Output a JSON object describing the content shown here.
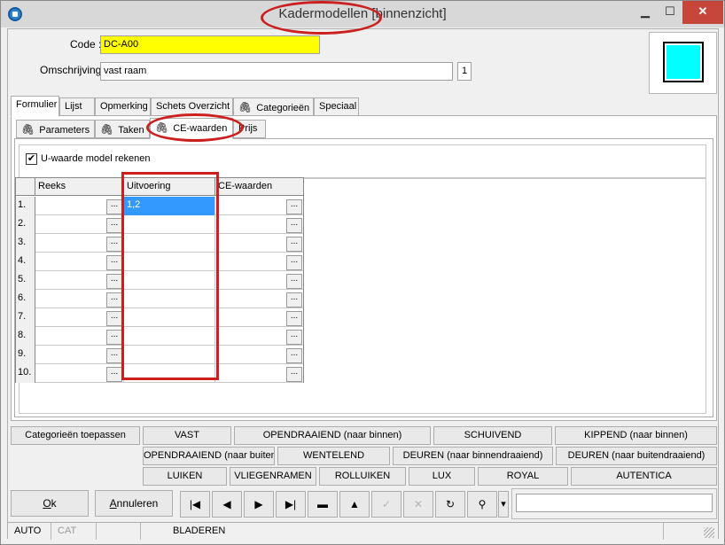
{
  "window": {
    "title": "Kadermodellen [binnenzicht]",
    "minimize_glyph": "▁",
    "maximize_glyph": "☐",
    "close_glyph": "✕"
  },
  "form": {
    "code_label": "Code :",
    "code_value": "DC-A00",
    "description_label": "Omschrijving :",
    "description_value": "vast raam",
    "count_value": "1",
    "swatch_color": "#00ffff"
  },
  "tabs": [
    {
      "label": "Formulier",
      "active": true
    },
    {
      "label": "Lijst"
    },
    {
      "label": "Opmerking"
    },
    {
      "label": "Schets Overzicht"
    },
    {
      "label": "Categorieën",
      "icon": "paperclip-icon"
    },
    {
      "label": "Speciaal"
    }
  ],
  "subtabs": [
    {
      "label": "Parameters",
      "icon": "paperclip-icon"
    },
    {
      "label": "Taken",
      "icon": "paperclip-icon"
    },
    {
      "label": "CE-waarden",
      "icon": "paperclip-icon",
      "active": true
    },
    {
      "label": "Prijs"
    }
  ],
  "checkbox": {
    "label": "U-waarde model rekenen",
    "checked": true
  },
  "grid": {
    "columns": [
      "Reeks",
      "Uitvoering",
      "CE-waarden"
    ],
    "rows": [
      {
        "num": "1.",
        "reeks": "",
        "uitvoering": "1,2",
        "ce": "",
        "selected": true
      },
      {
        "num": "2.",
        "reeks": "",
        "uitvoering": "",
        "ce": ""
      },
      {
        "num": "3.",
        "reeks": "",
        "uitvoering": "",
        "ce": ""
      },
      {
        "num": "4.",
        "reeks": "",
        "uitvoering": "",
        "ce": ""
      },
      {
        "num": "5.",
        "reeks": "",
        "uitvoering": "",
        "ce": ""
      },
      {
        "num": "6.",
        "reeks": "",
        "uitvoering": "",
        "ce": ""
      },
      {
        "num": "7.",
        "reeks": "",
        "uitvoering": "",
        "ce": ""
      },
      {
        "num": "8.",
        "reeks": "",
        "uitvoering": "",
        "ce": ""
      },
      {
        "num": "9.",
        "reeks": "",
        "uitvoering": "",
        "ce": ""
      },
      {
        "num": "10.",
        "reeks": "",
        "uitvoering": "",
        "ce": ""
      }
    ],
    "ellipsis": "..."
  },
  "category_apply_label": "Categorieën toepassen",
  "category_buttons": [
    [
      "VAST",
      "OPENDRAAIEND (naar binnen)",
      "SCHUIVEND",
      "KIPPEND (naar binnen)"
    ],
    [
      "OPENDRAAIEND (naar buiten)",
      "WENTELEND",
      "DEUREN (naar binnendraaiend)",
      "DEUREN (naar buitendraaiend)"
    ],
    [
      "LUIKEN",
      "VLIEGENRAMEN",
      "ROLLUIKEN",
      "LUX",
      "ROYAL",
      "AUTENTICA"
    ]
  ],
  "actions": {
    "ok_first": "O",
    "ok_rest": "k",
    "cancel_first": "A",
    "cancel_rest": "nnuleren"
  },
  "nav_buttons": [
    {
      "name": "first-record-icon",
      "glyph": "|◀"
    },
    {
      "name": "previous-record-icon",
      "glyph": "◀"
    },
    {
      "name": "next-record-icon",
      "glyph": "▶"
    },
    {
      "name": "last-record-icon",
      "glyph": "▶|"
    },
    {
      "name": "delete-record-icon",
      "glyph": "▬"
    },
    {
      "name": "edit-record-icon",
      "glyph": "▲"
    },
    {
      "name": "confirm-icon",
      "glyph": "✓",
      "disabled": true
    },
    {
      "name": "cancel-edit-icon",
      "glyph": "✕",
      "disabled": true
    },
    {
      "name": "refresh-icon",
      "glyph": "↻"
    },
    {
      "name": "binoculars-icon",
      "glyph": "⚲"
    }
  ],
  "dropdown_glyph": "▾",
  "search_value": "",
  "status": {
    "auto": "AUTO",
    "cat": "CAT",
    "mode": "BLADEREN"
  }
}
